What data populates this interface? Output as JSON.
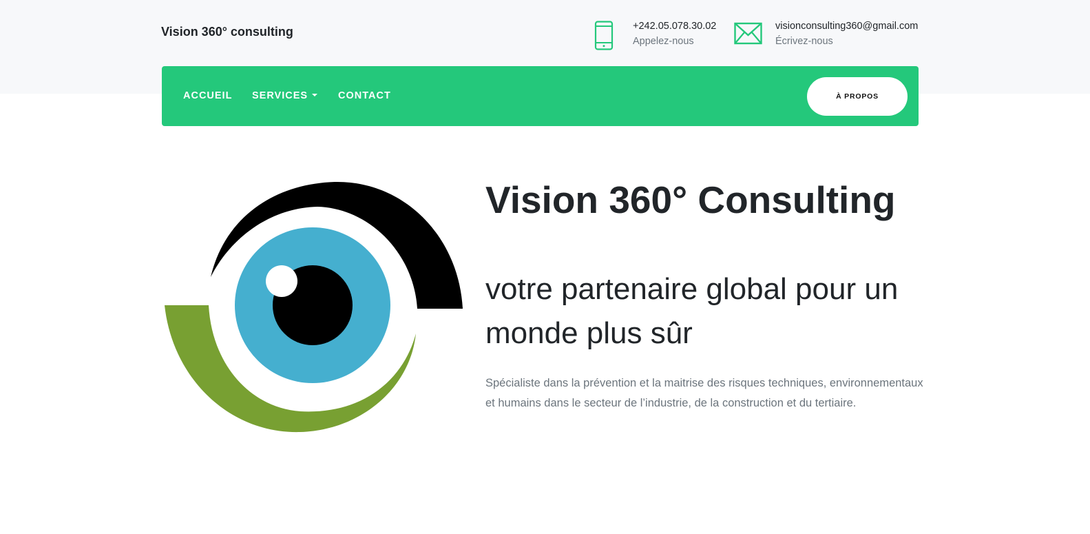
{
  "header": {
    "brand": "Vision 360° consulting",
    "phone": {
      "number": "+242.05.078.30.02",
      "label": "Appelez-nous",
      "icon": "phone-icon"
    },
    "email": {
      "address": "visionconsulting360@gmail.com",
      "label": "Écrivez-nous",
      "icon": "mail-icon"
    }
  },
  "nav": {
    "items": [
      "ACCUEIL",
      "SERVICES",
      "CONTACT"
    ],
    "about_button": "À PROPOS"
  },
  "hero": {
    "title": "Vision 360° Consulting",
    "subtitle": "votre partenaire global pour un monde plus sûr",
    "description": "Spécialiste dans la prévention et la maitrise des risques techniques, environnementaux et humains dans le secteur de l’industrie, de la construction et du tertiaire."
  },
  "colors": {
    "accent": "#24c87b",
    "top_band": "#f7f8fa",
    "logo_iris": "#45afcf",
    "logo_green": "#78a032",
    "logo_black": "#000000"
  }
}
